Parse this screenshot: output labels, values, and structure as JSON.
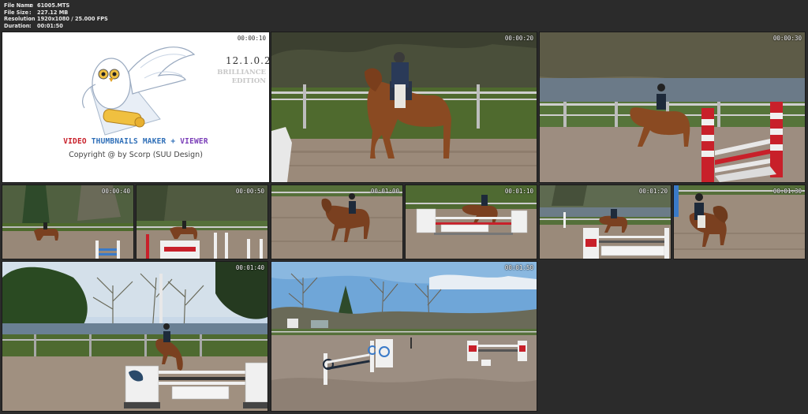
{
  "file_info": {
    "rows": [
      {
        "key": "File Name",
        "value": "61005.MTS"
      },
      {
        "key": "File Size",
        "value": "227.12 MB"
      },
      {
        "key": "Resolution",
        "value": "1920x1080 / 25.000 FPS"
      },
      {
        "key": "Duration",
        "value": "00:01:50"
      }
    ],
    "separator": ":"
  },
  "logo": {
    "timestamp": "00:00:10",
    "version": "12.1.0.2",
    "edition_line1": "BRILLIANCE",
    "edition_line2": "EDITION",
    "title_part1": "VIDEO",
    "title_part2": "THUMBNAILS MAKER",
    "title_plus": "+",
    "title_part3": "VIEWER",
    "copyright": "Copyright @ by Scorp (SUU Design)"
  },
  "thumbnails": [
    {
      "timestamp": "00:00:20"
    },
    {
      "timestamp": "00:00:30"
    },
    {
      "timestamp": "00:00:40"
    },
    {
      "timestamp": "00:00:50"
    },
    {
      "timestamp": "00:01:00"
    },
    {
      "timestamp": "00:01:10"
    },
    {
      "timestamp": "00:01:20"
    },
    {
      "timestamp": "00:01:30"
    },
    {
      "timestamp": "00:01:40"
    },
    {
      "timestamp": "00:01:50"
    }
  ],
  "colors": {
    "background": "#2b2b2b",
    "arena_sand": "#9b8a7a",
    "grass": "#4d6b2c",
    "horse": "#8a4a22",
    "sky": "#6fa6d8",
    "jump_red": "#c8202a"
  }
}
